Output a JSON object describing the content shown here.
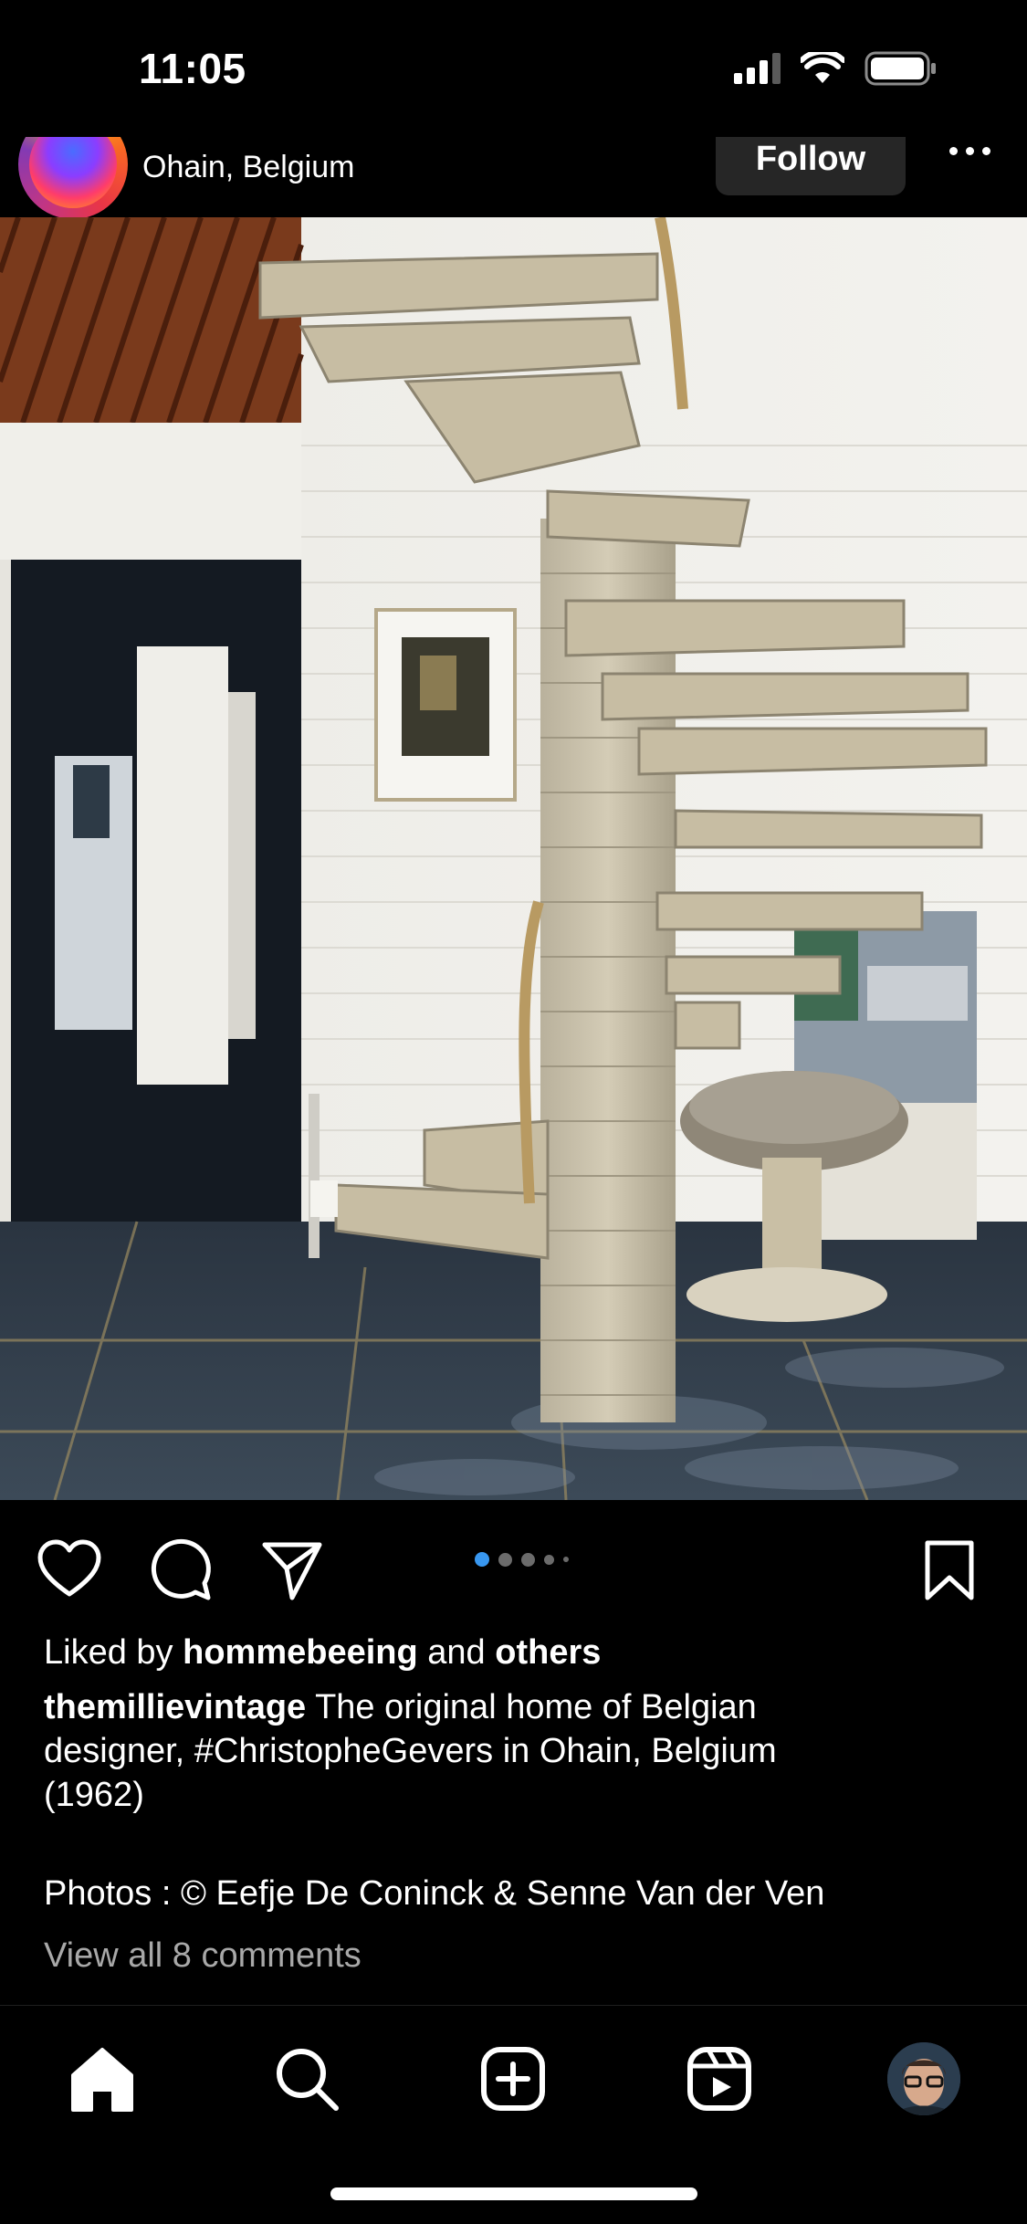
{
  "status_bar": {
    "time": "11:05",
    "icons": [
      "cellular-signal-icon",
      "wifi-icon",
      "battery-icon"
    ]
  },
  "post": {
    "location": "Ohain, Belgium",
    "follow_label": "Follow",
    "more_icon": "more-horizontal-icon",
    "carousel": {
      "total": 5,
      "active_index": 0
    },
    "liked_by_prefix": "Liked by",
    "liked_by_user": "hommebeeing",
    "liked_by_and": "and",
    "liked_by_others": "others",
    "caption_user": "themillievintage",
    "caption_text_1": "The original home of Belgian",
    "caption_text_2": "designer, #ChristopheGevers in Ohain, Belgium",
    "caption_text_3": "(1962)",
    "caption_credit": "Photos : © Eefje De Coninck & Senne Van der Ven",
    "comments_link": "View all 8 comments"
  },
  "colors": {
    "background": "#000000",
    "text": "#ffffff",
    "muted_text": "#a8a8a8",
    "active_dot": "#3897f0",
    "follow_button_bg": "#262626"
  },
  "nav": {
    "items": [
      "home-icon",
      "search-icon",
      "create-icon",
      "reels-icon",
      "profile-avatar"
    ]
  }
}
